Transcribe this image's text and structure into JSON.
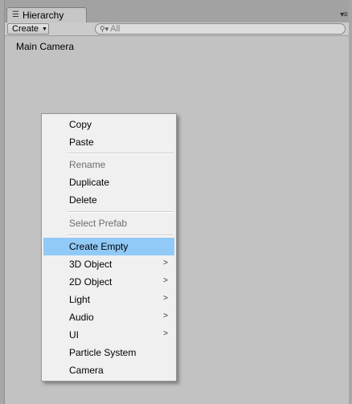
{
  "window": {
    "tab_label": "Hierarchy",
    "tab_icon": "hierarchy-list-icon",
    "pane_menu_icon": "pane-options-icon"
  },
  "toolbar": {
    "create_label": "Create",
    "search_placeholder": "All",
    "search_icon": "search-icon"
  },
  "hierarchy": {
    "items": [
      "Main Camera"
    ]
  },
  "context_menu": {
    "highlight_color": "#91c9f7",
    "items": [
      {
        "label": "Copy",
        "enabled": true,
        "submenu": false
      },
      {
        "label": "Paste",
        "enabled": true,
        "submenu": false
      },
      {
        "label": "Rename",
        "enabled": false,
        "submenu": false
      },
      {
        "label": "Duplicate",
        "enabled": true,
        "submenu": false
      },
      {
        "label": "Delete",
        "enabled": true,
        "submenu": false
      },
      {
        "label": "Select Prefab",
        "enabled": false,
        "submenu": false
      },
      {
        "label": "Create Empty",
        "enabled": true,
        "submenu": false,
        "highlighted": true
      },
      {
        "label": "3D Object",
        "enabled": true,
        "submenu": true
      },
      {
        "label": "2D Object",
        "enabled": true,
        "submenu": true
      },
      {
        "label": "Light",
        "enabled": true,
        "submenu": true
      },
      {
        "label": "Audio",
        "enabled": true,
        "submenu": true
      },
      {
        "label": "UI",
        "enabled": true,
        "submenu": true
      },
      {
        "label": "Particle System",
        "enabled": true,
        "submenu": false
      },
      {
        "label": "Camera",
        "enabled": true,
        "submenu": false
      }
    ]
  }
}
